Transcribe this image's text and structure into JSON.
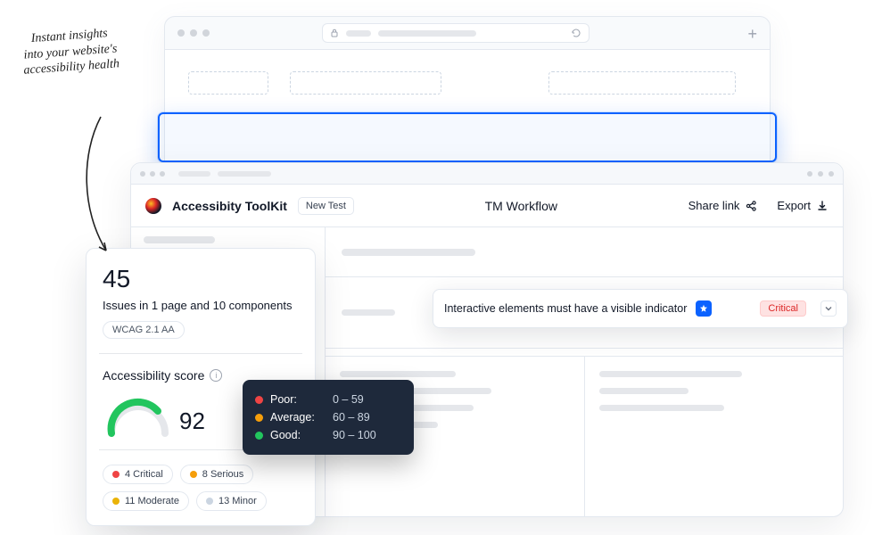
{
  "annotation": "Instant insights into your website's accessibility health",
  "browser": {
    "plus": "+"
  },
  "app": {
    "name": "Accessibity ToolKit",
    "new_test": "New Test",
    "workflow_title": "TM Workflow",
    "share": "Share link",
    "export": "Export"
  },
  "issue": {
    "text": "Interactive elements must have a visible indicator",
    "tag": "Critical"
  },
  "score_card": {
    "count": "45",
    "subtitle": "Issues in 1 page and 10 components",
    "wcag": "WCAG 2.1 AA",
    "title": "Accessibility score",
    "score": "92"
  },
  "chart_data": {
    "type": "gauge",
    "value": 92,
    "range": [
      0,
      100
    ],
    "thresholds": {
      "poor": [
        0,
        59
      ],
      "average": [
        60,
        89
      ],
      "good": [
        90,
        100
      ]
    },
    "colors": {
      "poor": "#ef4444",
      "average": "#f59e0b",
      "good": "#22c55e"
    }
  },
  "legend": [
    {
      "label": "Poor:",
      "range": "0 – 59",
      "color": "#ef4444"
    },
    {
      "label": "Average:",
      "range": "60 – 89",
      "color": "#f59e0b"
    },
    {
      "label": "Good:",
      "range": "90 – 100",
      "color": "#22c55e"
    }
  ],
  "severities": [
    {
      "count": "4 Critical",
      "color": "#ef4444"
    },
    {
      "count": "8 Serious",
      "color": "#f59e0b"
    },
    {
      "count": "11 Moderate",
      "color": "#eab308"
    },
    {
      "count": "13 Minor",
      "color": "#cbd5e1"
    }
  ]
}
